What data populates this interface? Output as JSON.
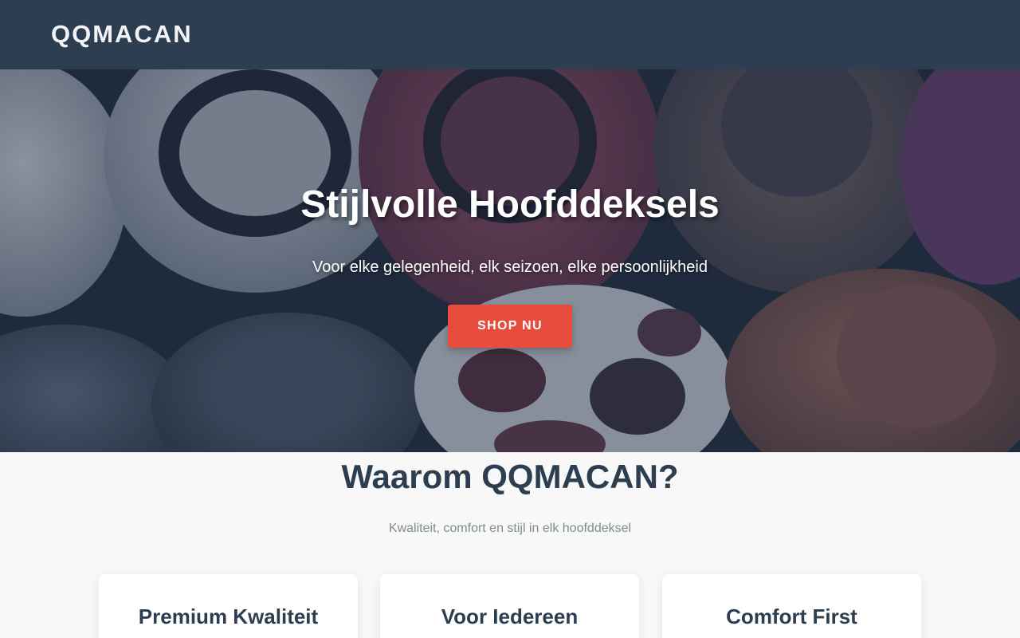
{
  "header": {
    "logo": "QQMACAN"
  },
  "hero": {
    "title": "Stijlvolle Hoofddeksels",
    "subtitle": "Voor elke gelegenheid, elk seizoen, elke persoonlijkheid",
    "cta_label": "SHOP NU"
  },
  "why": {
    "title": "Waarom QQMACAN?",
    "subtitle": "Kwaliteit, comfort en stijl in elk hoofddeksel",
    "cards": [
      {
        "title": "Premium Kwaliteit"
      },
      {
        "title": "Voor Iedereen"
      },
      {
        "title": "Comfort First"
      }
    ]
  },
  "colors": {
    "navbar": "#2c3e50",
    "accent": "#e74c3c",
    "heading": "#2c3e50",
    "muted": "#7f8c8d",
    "section_bg": "#f8f8f8"
  }
}
